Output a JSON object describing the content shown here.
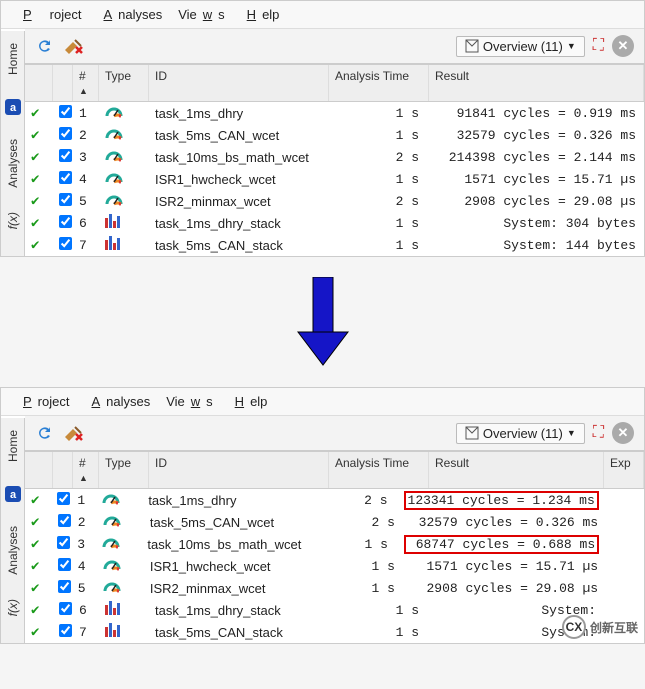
{
  "menu": {
    "project": "Project",
    "analyses": "Analyses",
    "views": "Views",
    "help": "Help"
  },
  "toolbar": {
    "overview_label": "Overview (11)",
    "overview_caret": "▼"
  },
  "sidebar": {
    "tabs": [
      "Home",
      "Analyses",
      "f(x)"
    ]
  },
  "columns": {
    "num": "#",
    "type": "Type",
    "id": "ID",
    "time": "Analysis Time",
    "result": "Result",
    "exp": "Exp"
  },
  "panel_top": {
    "rows": [
      {
        "n": "1",
        "icon": "gauge",
        "id": "task_1ms_dhry",
        "time": "1 s",
        "result": " 91841 cycles = 0.919 ms",
        "hl": false
      },
      {
        "n": "2",
        "icon": "gauge",
        "id": "task_5ms_CAN_wcet",
        "time": "1 s",
        "result": " 32579 cycles = 0.326 ms",
        "hl": false
      },
      {
        "n": "3",
        "icon": "gauge",
        "id": "task_10ms_bs_math_wcet",
        "time": "2 s",
        "result": "214398 cycles = 2.144 ms",
        "hl": false
      },
      {
        "n": "4",
        "icon": "gauge",
        "id": "ISR1_hwcheck_wcet",
        "time": "1 s",
        "result": "  1571 cycles = 15.71 µs",
        "hl": false
      },
      {
        "n": "5",
        "icon": "gauge",
        "id": "ISR2_minmax_wcet",
        "time": "2 s",
        "result": "  2908 cycles = 29.08 µs",
        "hl": false
      },
      {
        "n": "6",
        "icon": "bars",
        "id": "task_1ms_dhry_stack",
        "time": "1 s",
        "result": "     System: 304 bytes",
        "hl": false
      },
      {
        "n": "7",
        "icon": "bars",
        "id": "task_5ms_CAN_stack",
        "time": "1 s",
        "result": "     System: 144 bytes",
        "hl": false
      }
    ]
  },
  "panel_bottom": {
    "rows": [
      {
        "n": "1",
        "icon": "gauge",
        "id": "task_1ms_dhry",
        "time": "2 s",
        "result": "123341 cycles = 1.234 ms",
        "hl": true
      },
      {
        "n": "2",
        "icon": "gauge",
        "id": "task_5ms_CAN_wcet",
        "time": "2 s",
        "result": " 32579 cycles = 0.326 ms",
        "hl": false
      },
      {
        "n": "3",
        "icon": "gauge",
        "id": "task_10ms_bs_math_wcet",
        "time": "1 s",
        "result": " 68747 cycles = 0.688 ms",
        "hl": true
      },
      {
        "n": "4",
        "icon": "gauge",
        "id": "ISR1_hwcheck_wcet",
        "time": "1 s",
        "result": "  1571 cycles = 15.71 µs",
        "hl": false
      },
      {
        "n": "5",
        "icon": "gauge",
        "id": "ISR2_minmax_wcet",
        "time": "1 s",
        "result": "  2908 cycles = 29.08 µs",
        "hl": false
      },
      {
        "n": "6",
        "icon": "bars",
        "id": "task_1ms_dhry_stack",
        "time": "1 s",
        "result": "     System:",
        "hl": false
      },
      {
        "n": "7",
        "icon": "bars",
        "id": "task_5ms_CAN_stack",
        "time": "1 s",
        "result": "     System:",
        "hl": false
      }
    ]
  },
  "watermark": "创新互联"
}
